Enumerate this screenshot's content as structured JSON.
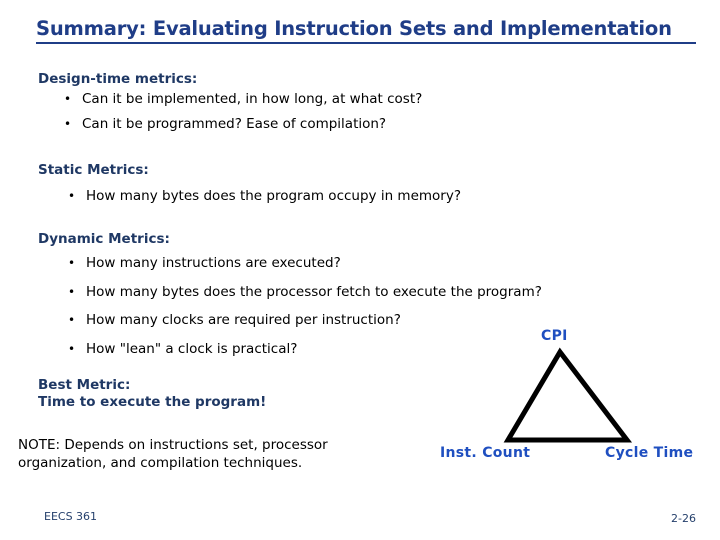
{
  "slide": {
    "title": "Summary: Evaluating Instruction Sets and Implementation",
    "sections": [
      {
        "heading": "Design-time metrics:",
        "bullets": [
          "Can it be implemented, in how long, at what cost?",
          "Can it be programmed?  Ease of compilation?"
        ]
      },
      {
        "heading": "Static Metrics:",
        "bullets": [
          "How many bytes does the program occupy in memory?"
        ]
      },
      {
        "heading": "Dynamic Metrics:",
        "bullets": [
          "How many instructions are executed?",
          "How many bytes does the processor fetch to execute the program?",
          "How many clocks are required per instruction?",
          "How  \"lean\" a clock is practical?"
        ]
      }
    ],
    "best_metric": {
      "line1": "Best Metric:",
      "line2": "Time to execute the program!"
    },
    "note": {
      "line1": "NOTE: Depends on instructions set, processor",
      "line2": "organization, and compilation techniques."
    },
    "diagram": {
      "apex_label": "CPI",
      "bottom_left_label": "Inst. Count",
      "bottom_right_label": "Cycle Time",
      "outline_color": "#000000",
      "label_color": "#1F4FC0"
    },
    "footer": {
      "course": "EECS 361",
      "page": "2-26"
    },
    "colors": {
      "title": "#1F3D87",
      "heading": "#1F3864",
      "body": "#000000",
      "accent": "#1F4FC0",
      "footer": "#243F6B",
      "background": "#FFFFFF"
    }
  }
}
